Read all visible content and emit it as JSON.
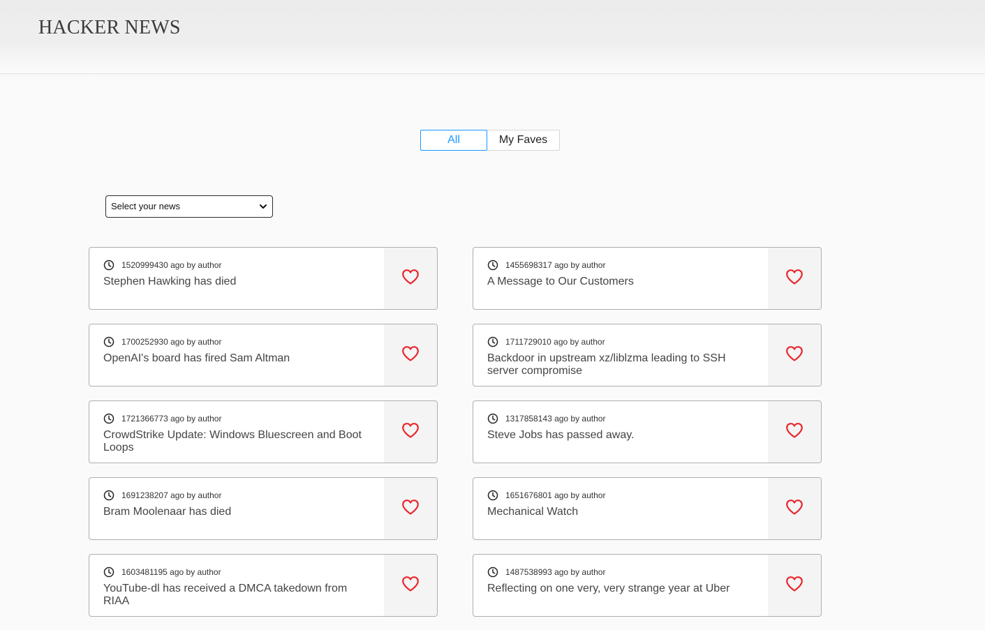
{
  "header": {
    "logo": "HACKER NEWS"
  },
  "tabs": [
    {
      "label": "All",
      "active": true
    },
    {
      "label": "My Faves",
      "active": false
    }
  ],
  "news_select": {
    "selected": "Select your news"
  },
  "colors": {
    "accent": "#1797ff",
    "heart": "#e8262d"
  },
  "icons": {
    "time": "clock-icon",
    "favorite": "heart-outline-icon",
    "dropdown": "chevron-down-icon"
  },
  "cards": [
    {
      "meta": "1520999430 ago by author",
      "title": "Stephen Hawking has died"
    },
    {
      "meta": "1455698317 ago by author",
      "title": "A Message to Our Customers"
    },
    {
      "meta": "1700252930 ago by author",
      "title": "OpenAI's board has fired Sam Altman"
    },
    {
      "meta": "1711729010 ago by author",
      "title": "Backdoor in upstream xz/liblzma leading to SSH server compromise"
    },
    {
      "meta": "1721366773 ago by author",
      "title": "CrowdStrike Update: Windows Bluescreen and Boot Loops"
    },
    {
      "meta": "1317858143 ago by author",
      "title": "Steve Jobs has passed away."
    },
    {
      "meta": "1691238207 ago by author",
      "title": "Bram Moolenaar has died"
    },
    {
      "meta": "1651676801 ago by author",
      "title": "Mechanical Watch"
    },
    {
      "meta": "1603481195 ago by author",
      "title": "YouTube-dl has received a DMCA takedown from RIAA"
    },
    {
      "meta": "1487538993 ago by author",
      "title": "Reflecting on one very, very strange year at Uber"
    }
  ]
}
